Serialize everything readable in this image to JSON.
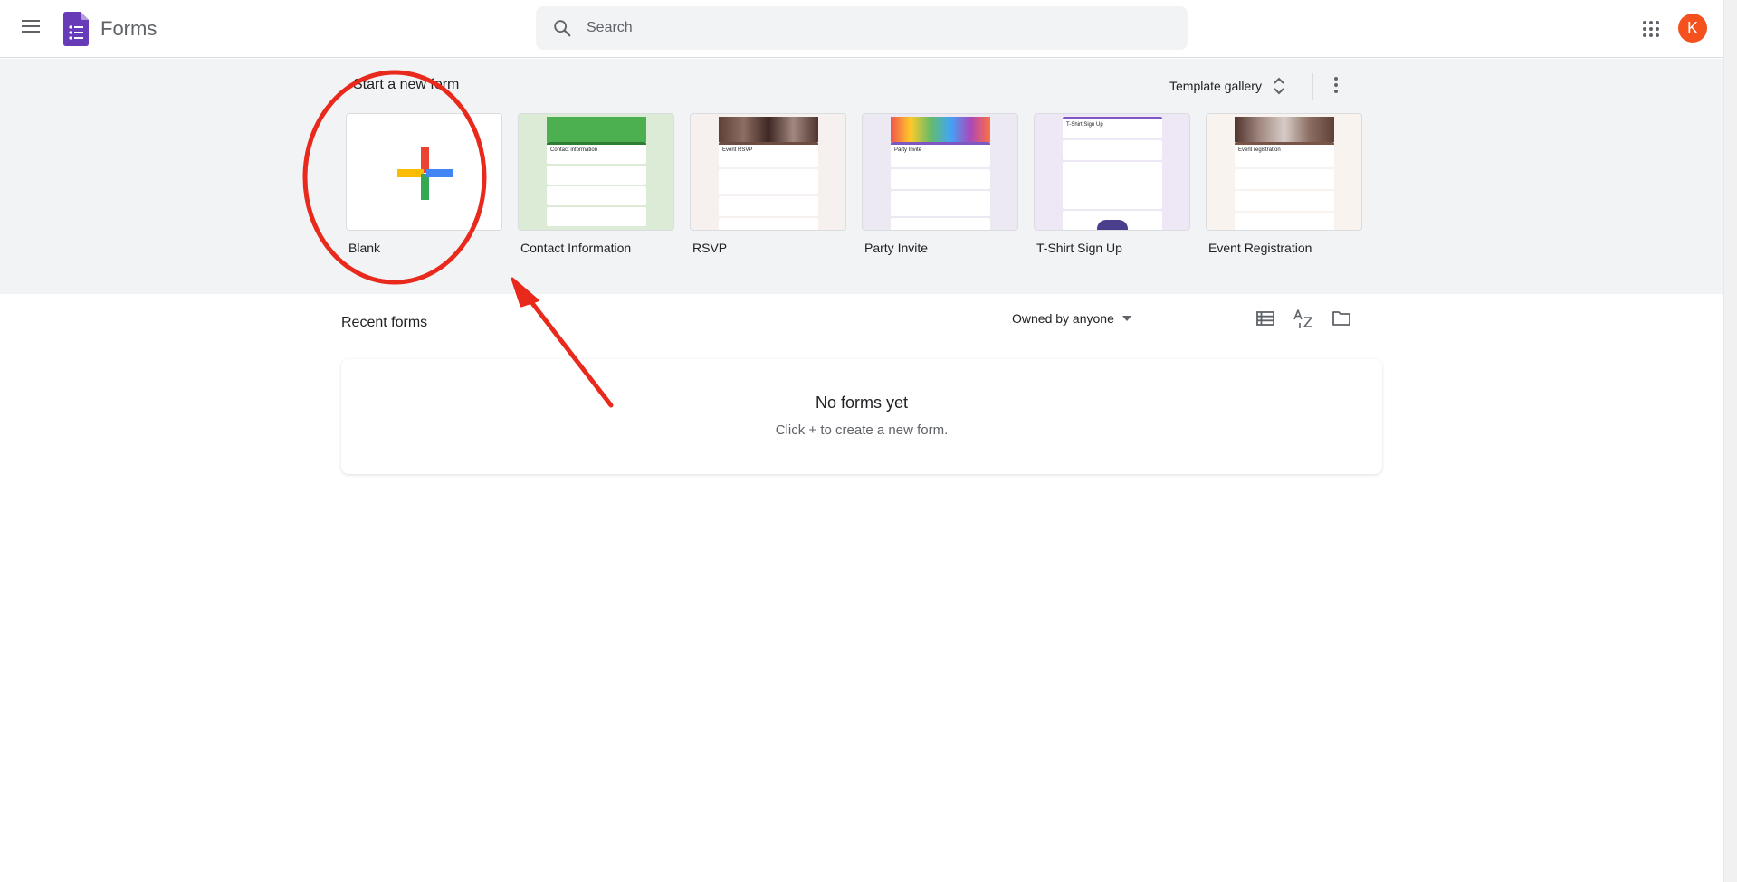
{
  "header": {
    "app_title": "Forms",
    "search_placeholder": "Search",
    "avatar_initial": "K",
    "logo_color": "#673ab7",
    "avatar_color": "#f4511e"
  },
  "templates": {
    "section_title": "Start a new form",
    "gallery_label": "Template gallery",
    "items": [
      {
        "label": "Blank",
        "theme": "#ffffff"
      },
      {
        "label": "Contact Information",
        "theme": "#dcebd6",
        "header_color": "#4caf50",
        "form_title": "Contact information"
      },
      {
        "label": "RSVP",
        "theme": "#f6f1ee",
        "header_color": "#6d4c41",
        "form_title": "Event RSVP"
      },
      {
        "label": "Party Invite",
        "theme": "#ece9f3",
        "header_color": "#7e57c2",
        "form_title": "Party Invite"
      },
      {
        "label": "T-Shirt Sign Up",
        "theme": "#ede7f6",
        "header_color": "#7e57c2",
        "form_title": "T-Shirt Sign Up"
      },
      {
        "label": "Event Registration",
        "theme": "#f8f3ef",
        "header_color": "#795548",
        "form_title": "Event registration"
      }
    ]
  },
  "recent": {
    "title": "Recent forms",
    "owner_filter": "Owned by anyone",
    "empty_title": "No forms yet",
    "empty_subtitle": "Click + to create a new form."
  },
  "annotation": {
    "color": "#e8291c"
  }
}
